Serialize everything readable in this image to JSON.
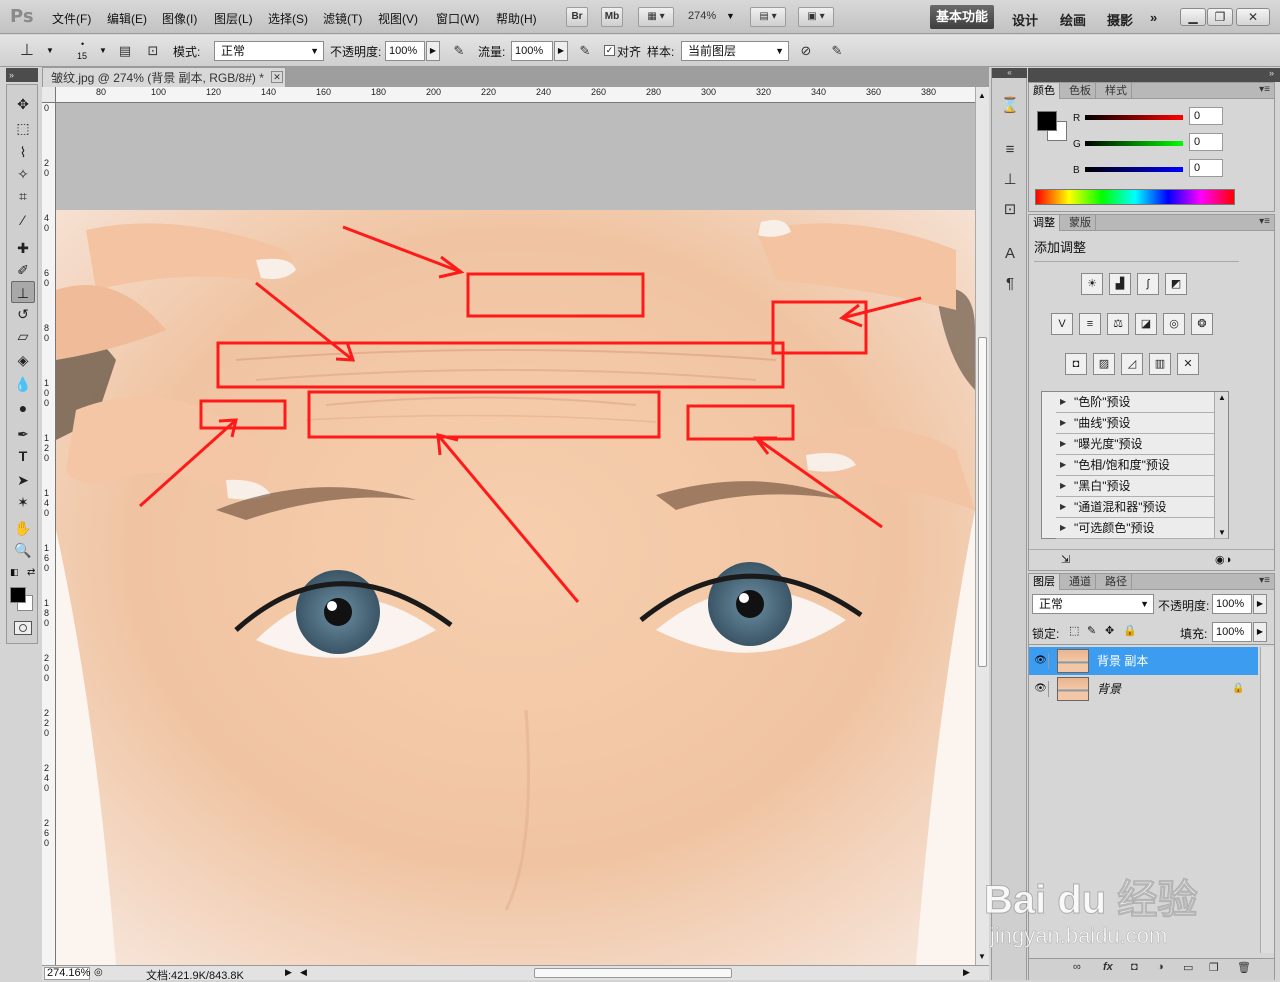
{
  "app": {
    "logo": "Ps"
  },
  "menu": [
    "文件(F)",
    "编辑(E)",
    "图像(I)",
    "图层(L)",
    "选择(S)",
    "滤镜(T)",
    "视图(V)",
    "窗口(W)",
    "帮助(H)"
  ],
  "menubar_buttons": {
    "br": "Br",
    "mb": "Mb",
    "zoom": "274%"
  },
  "workspaces": {
    "active": "基本功能",
    "others": [
      "设计",
      "绘画",
      "摄影"
    ],
    "more": "»"
  },
  "options": {
    "brush_size": "15",
    "mode_label": "模式:",
    "mode_value": "正常",
    "opacity_label": "不透明度:",
    "opacity_value": "100%",
    "flow_label": "流量:",
    "flow_value": "100%",
    "aligned_label": "对齐",
    "sample_label": "样本:",
    "sample_value": "当前图层"
  },
  "document": {
    "tab_title": "皱纹.jpg @ 274% (背景 副本, RGB/8#) *",
    "ruler_top": [
      "80",
      "100",
      "120",
      "140",
      "160",
      "180",
      "200",
      "220",
      "240",
      "260",
      "280",
      "300",
      "320",
      "340",
      "360",
      "380"
    ],
    "ruler_left": [
      "0",
      "20",
      "40",
      "60",
      "80",
      "100",
      "120",
      "140",
      "160",
      "180",
      "200",
      "220",
      "240",
      "260"
    ],
    "status_zoom": "274.16%",
    "status_doc": "文档:421.9K/843.8K"
  },
  "color_panel": {
    "tabs": [
      "颜色",
      "色板",
      "样式"
    ],
    "channels": [
      {
        "label": "R",
        "value": "0"
      },
      {
        "label": "G",
        "value": "0"
      },
      {
        "label": "B",
        "value": "0"
      }
    ]
  },
  "adjust_panel": {
    "tabs": [
      "调整",
      "蒙版"
    ],
    "title": "添加调整",
    "presets": [
      "\"色阶\"预设",
      "\"曲线\"预设",
      "\"曝光度\"预设",
      "\"色相/饱和度\"预设",
      "\"黑白\"预设",
      "\"通道混和器\"预设",
      "\"可选颜色\"预设"
    ]
  },
  "layers_panel": {
    "tabs": [
      "图层",
      "通道",
      "路径"
    ],
    "blend_mode": "正常",
    "opacity_label": "不透明度:",
    "opacity_value": "100%",
    "lock_label": "锁定:",
    "fill_label": "填充:",
    "fill_value": "100%",
    "layers": [
      {
        "name": "背景 副本",
        "selected": true
      },
      {
        "name": "背景",
        "selected": false
      }
    ]
  },
  "watermark": {
    "brand": "Bai du 经验",
    "url": "jingyan.baidu.com"
  },
  "colors": {
    "annotation_red": "#ff1a1a",
    "selection_blue": "#3c9cf0",
    "active_workspace": "#4a4a4a"
  }
}
